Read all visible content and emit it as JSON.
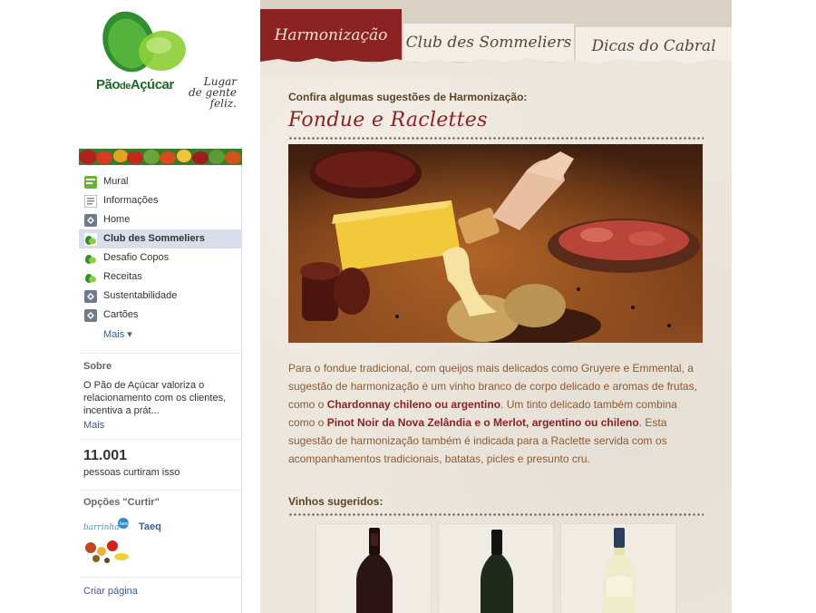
{
  "brand": {
    "name_main": "Pão",
    "name_de": "de",
    "name_end": "Açúcar",
    "tagline_1": "Lugar",
    "tagline_2": "de gente",
    "tagline_3": "feliz."
  },
  "nav": {
    "items": [
      {
        "label": "Mural",
        "icon": "wall-icon"
      },
      {
        "label": "Informações",
        "icon": "info-icon"
      },
      {
        "label": "Home",
        "icon": "app-icon"
      },
      {
        "label": "Club des Sommeliers",
        "icon": "pao-de-acucar-app-icon",
        "active": true
      },
      {
        "label": "Desafio Copos",
        "icon": "pao-de-acucar-app-icon"
      },
      {
        "label": "Receitas",
        "icon": "pao-de-acucar-app-icon"
      },
      {
        "label": "Sustentabilidade",
        "icon": "app-icon"
      },
      {
        "label": "Cartões",
        "icon": "app-icon"
      }
    ],
    "more": "Mais ▾"
  },
  "about": {
    "title": "Sobre",
    "text": "O Pão de Açúcar valoriza o relacionamento com os clientes, incentiva a prát...",
    "more": "Mais"
  },
  "likes": {
    "count": "11.001",
    "label": "pessoas curtiram isso"
  },
  "options": {
    "title": "Opções \"Curtir\"",
    "page_name": "Taeq",
    "logo_text": "barrinha",
    "logo_badge": "taeq"
  },
  "footer": {
    "create_page": "Criar página"
  },
  "tabs": [
    {
      "label": "Harmonização",
      "active": true
    },
    {
      "label": "Club des Sommeliers"
    },
    {
      "label": "Dicas do Cabral"
    }
  ],
  "content": {
    "intro": "Confira algumas sugestões de Harmonização:",
    "heading": "Fondue e Raclettes",
    "desc_1": "Para o fondue tradicional, com queijos mais delicados como Gruyere e Emmental, a sugestão de harmonização é um vinho branco de corpo delicado e aromas de frutas, como o ",
    "desc_2": "Chardonnay chileno ou argentino",
    "desc_3": ". Um tinto delicado também combina como o ",
    "desc_4": "Pinot Noir da Nova Zelândia e o Merlot, argentino ou chileno",
    "desc_5": ". Esta sugestão de harmonização também é indicada para a Raclette servida com os acompanhamentos tradicionais, batatas, picles e presunto cru.",
    "wines_title": "Vinhos sugeridos:"
  },
  "colors": {
    "accent": "#8b2325",
    "facebook_link": "#3b5998",
    "text_brown": "#8a5a34",
    "brand_green": "#1d6b2c"
  }
}
